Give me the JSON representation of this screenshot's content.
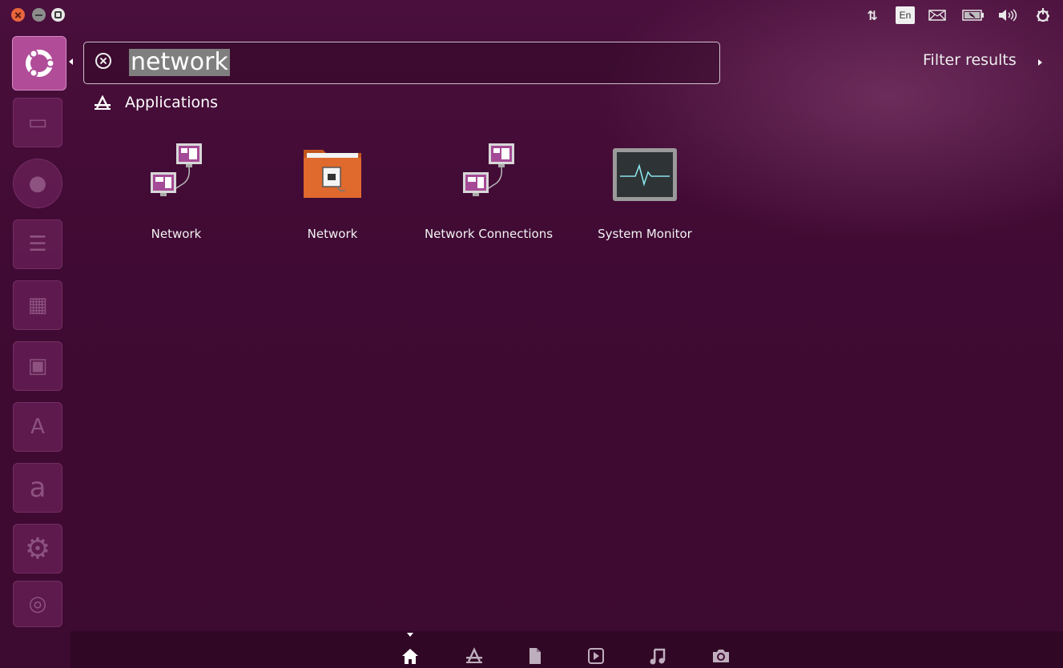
{
  "window": {
    "close_label": "",
    "min_label": "",
    "max_label": ""
  },
  "tray": {
    "network_icon": "network-updown-icon",
    "language": "En",
    "mail_icon": "mail-icon",
    "battery_icon": "battery-icon",
    "sound_icon": "speaker-icon",
    "power_icon": "power-gear-icon"
  },
  "launcher": {
    "items": [
      {
        "name": "ubuntu-dash-home",
        "glyph": ""
      },
      {
        "name": "files",
        "glyph": "▭"
      },
      {
        "name": "firefox",
        "glyph": "●"
      },
      {
        "name": "writer",
        "glyph": "☰"
      },
      {
        "name": "calc",
        "glyph": "▦"
      },
      {
        "name": "impress",
        "glyph": "▣"
      },
      {
        "name": "software-center",
        "glyph": "A"
      },
      {
        "name": "amazon",
        "glyph": "a"
      },
      {
        "name": "system-settings",
        "glyph": "⚙"
      },
      {
        "name": "workspaces",
        "glyph": "◎"
      }
    ]
  },
  "search": {
    "query": "network"
  },
  "filter": {
    "label": "Filter results"
  },
  "category": {
    "title": "Applications",
    "icon": "applications-icon"
  },
  "results": [
    {
      "label": "Network",
      "icon": "network-computers-icon"
    },
    {
      "label": "Network",
      "icon": "network-folder-icon"
    },
    {
      "label": "Network Connections",
      "icon": "network-computers-icon"
    },
    {
      "label": "System Monitor",
      "icon": "system-monitor-icon"
    }
  ],
  "lenses": [
    {
      "name": "home-lens",
      "active": true
    },
    {
      "name": "applications-lens",
      "active": false
    },
    {
      "name": "files-lens",
      "active": false
    },
    {
      "name": "video-lens",
      "active": false
    },
    {
      "name": "music-lens",
      "active": false
    },
    {
      "name": "photo-lens",
      "active": false
    }
  ],
  "colors": {
    "background": "#3f0a33",
    "launcher_home": "#b04c98",
    "selection": "#7f7f7f",
    "folder_orange": "#e0692e"
  }
}
